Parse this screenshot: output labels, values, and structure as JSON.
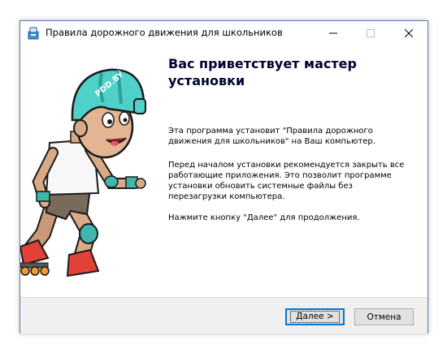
{
  "window": {
    "title": "Правила дорожного движения для школьников"
  },
  "titlebar_icons": {
    "app": "installer-icon",
    "minimize": "minimize-icon",
    "maximize": "maximize-icon",
    "close": "close-icon"
  },
  "illustration": {
    "description_icon": "boy-rollerblading-illustration",
    "helmet_text": "PDD.BY"
  },
  "main": {
    "heading": "Вас приветствует мастер установки",
    "paragraph1": "Эта программа установит \"Правила дорожного движения для школьников\" на Ваш компьютер.",
    "paragraph2": "Перед началом установки рекомендуется закрыть все работающие приложения. Это позволит программе установки обновить системные файлы без перезагрузки компьютера.",
    "paragraph3": "Нажмите кнопку \"Далее\" для продолжения."
  },
  "footer": {
    "next_label": "Далее >",
    "cancel_label": "Отмена"
  },
  "colors": {
    "accent_focus": "#0078d7",
    "helmet": "#4fd0c8",
    "skate": "#e2413a",
    "wheels": "#f39a2c"
  }
}
